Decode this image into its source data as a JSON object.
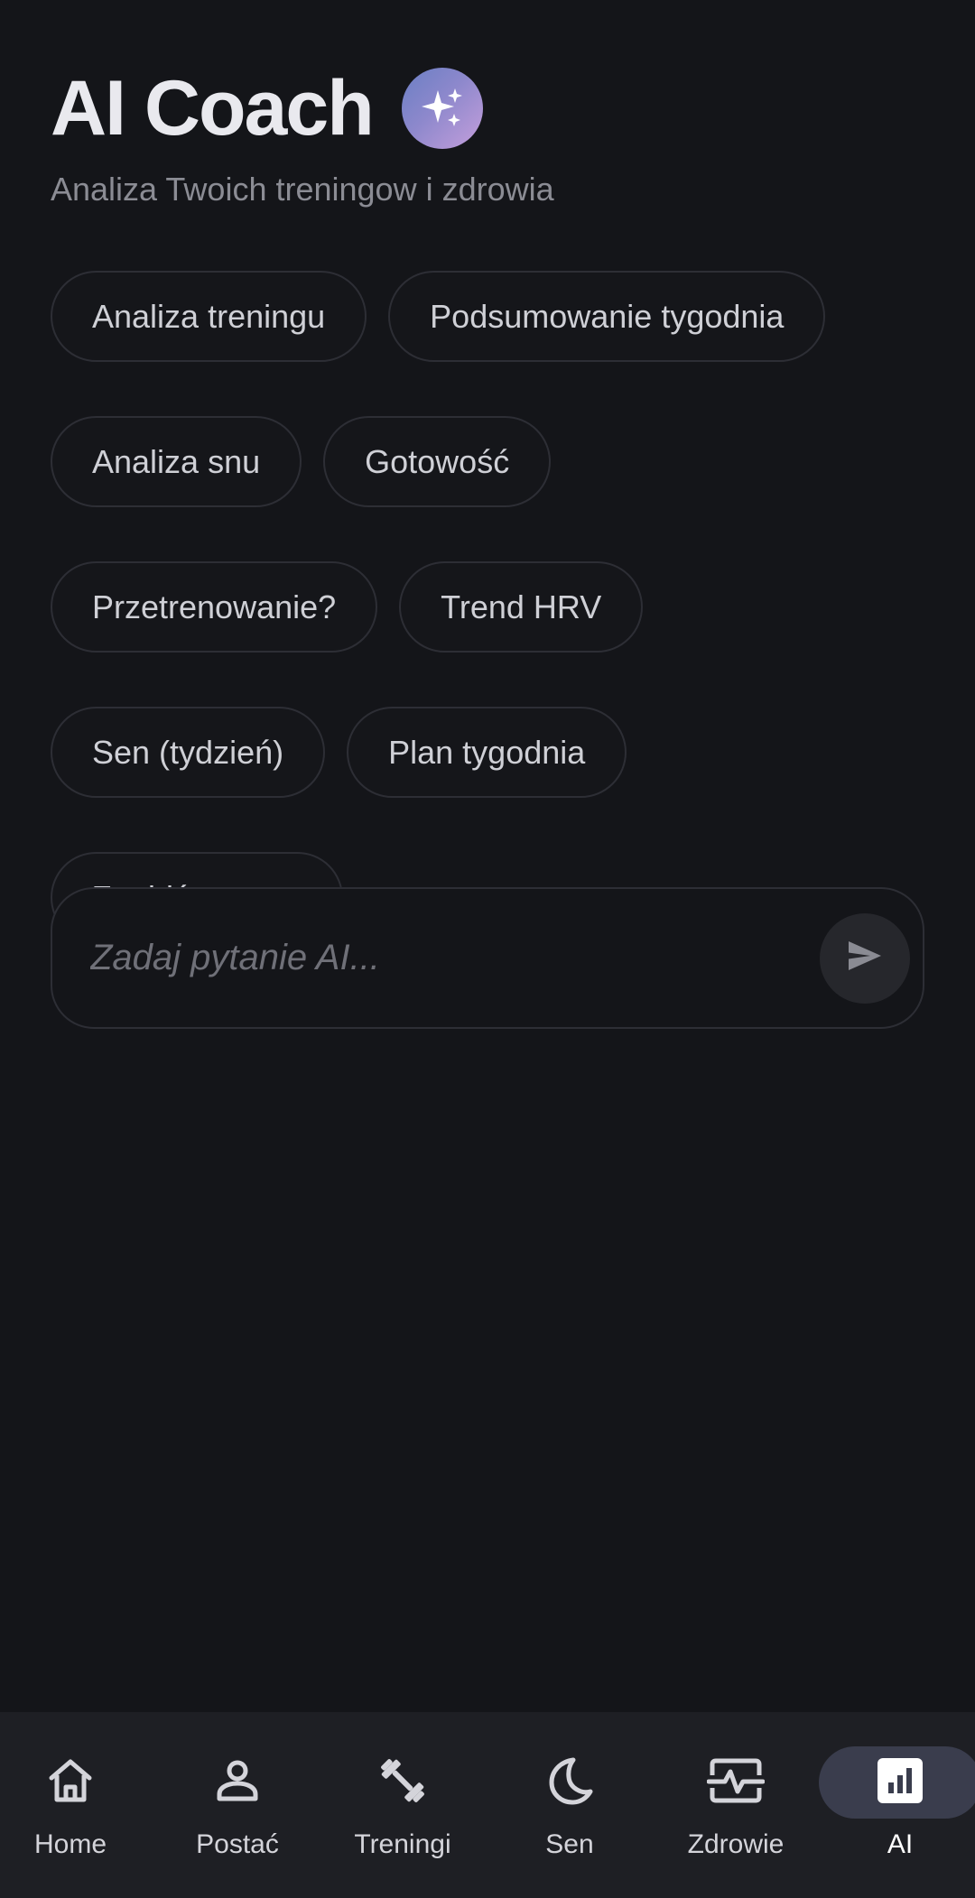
{
  "header": {
    "title": "AI Coach",
    "subtitle": "Analiza Twoich treningow i zdrowia",
    "badge_icon": "sparkles-icon"
  },
  "chips": [
    {
      "id": "analiza-treningu",
      "label": "Analiza treningu"
    },
    {
      "id": "podsumowanie-tygodnia",
      "label": "Podsumowanie tygodnia"
    },
    {
      "id": "analiza-snu",
      "label": "Analiza snu"
    },
    {
      "id": "gotowosc",
      "label": "Gotowość"
    },
    {
      "id": "przetrenowanie",
      "label": "Przetrenowanie?"
    },
    {
      "id": "trend-hrv",
      "label": "Trend HRV"
    },
    {
      "id": "sen-tydzien",
      "label": "Sen (tydzień)"
    },
    {
      "id": "plan-tygodnia",
      "label": "Plan tygodnia"
    },
    {
      "id": "znajdz-wzorce",
      "label": "Znajdź wzorce"
    }
  ],
  "ask": {
    "placeholder": "Zadaj pytanie AI...",
    "value": "",
    "send_icon": "send-icon"
  },
  "nav": {
    "items": [
      {
        "label": "Home",
        "icon": "home-icon"
      },
      {
        "label": "Postać",
        "icon": "person-icon"
      },
      {
        "label": "Treningi",
        "icon": "dumbbell-icon"
      },
      {
        "label": "Sen",
        "icon": "moon-icon"
      },
      {
        "label": "Zdrowie",
        "icon": "health-monitor-icon"
      },
      {
        "label": "AI",
        "icon": "bar-chart-icon"
      }
    ],
    "active": "AI"
  },
  "colors": {
    "background": "#141519",
    "chip_border": "#2d2e35",
    "nav_background": "#1e1f24",
    "active_pill": "#3a3d4d",
    "badge_gradient_start": "#6a7fc4",
    "badge_gradient_end": "#c59fdc"
  }
}
